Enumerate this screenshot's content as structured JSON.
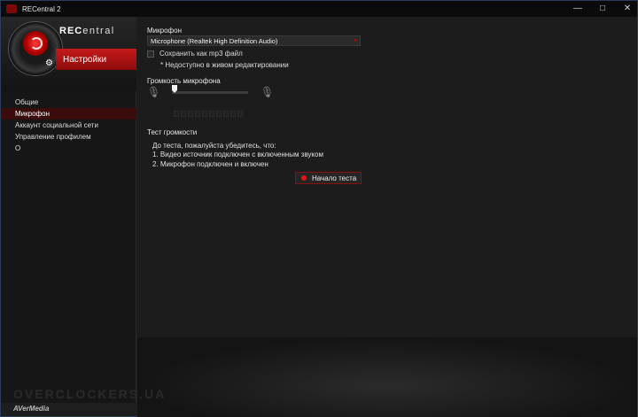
{
  "window": {
    "title": "RECentral 2"
  },
  "titlebar": {
    "minimize": "—",
    "maximize": "□",
    "close": "✕"
  },
  "brand": {
    "name_rec": "REC",
    "name_rest": "entral"
  },
  "sidebar": {
    "settings_title": "Настройки",
    "items": [
      {
        "label": "Общие",
        "active": false
      },
      {
        "label": "Микрофон",
        "active": true
      },
      {
        "label": "Аккаунт социальной сети",
        "active": false
      },
      {
        "label": "Управление профилем",
        "active": false
      },
      {
        "label": "О",
        "active": false
      }
    ]
  },
  "microphone": {
    "section_label": "Микрофон",
    "device_selected": "Microphone (Realtek High Definition Audio)",
    "save_mp3_label": "Сохранить как mp3 файл",
    "save_mp3_checked": false,
    "note": "* Недоступно в живом редактировании",
    "volume_label": "Громкость микрофона",
    "volume_level": 0
  },
  "volume_test": {
    "section_label": "Тест громкости",
    "line0": "До теста, пожалуйста убедитесь, что:",
    "line1": "1. Видео источник подключен с включенным звуком",
    "line2": "2. Микрофон подключен и включен",
    "start_button": "Начало теста"
  },
  "footer": {
    "watermark": "OVERCLOCKERS.UA",
    "vendor": "AVerMedia"
  },
  "colors": {
    "accent": "#c61a1a",
    "background": "#1c1c1c"
  }
}
